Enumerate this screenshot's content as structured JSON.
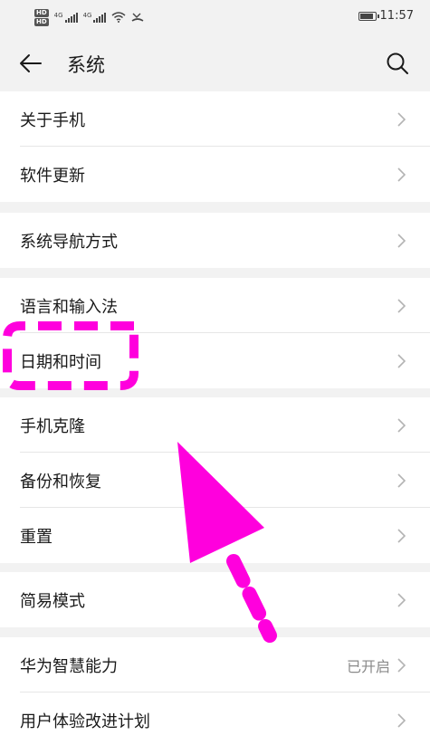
{
  "status_bar": {
    "hd_badges": [
      "HD",
      "HD"
    ],
    "sim1_label": "4G",
    "sim2_label": "4G",
    "time": "11:57",
    "battery_level": 0.9
  },
  "header": {
    "title": "系统",
    "back_icon": "arrow-left-icon",
    "search_icon": "search-icon"
  },
  "groups": [
    {
      "items": [
        {
          "label": "关于手机"
        },
        {
          "label": "软件更新"
        }
      ]
    },
    {
      "items": [
        {
          "label": "系统导航方式"
        }
      ]
    },
    {
      "items": [
        {
          "label": "语言和输入法"
        },
        {
          "label": "日期和时间"
        }
      ]
    },
    {
      "items": [
        {
          "label": "手机克隆"
        },
        {
          "label": "备份和恢复"
        },
        {
          "label": "重置"
        }
      ]
    },
    {
      "items": [
        {
          "label": "简易模式"
        }
      ]
    },
    {
      "items": [
        {
          "label": "华为智慧能力",
          "value": "已开启"
        },
        {
          "label": "用户体验改进计划"
        }
      ]
    }
  ],
  "annotation": {
    "color": "#ff00dd",
    "highlight_target": "日期和时间",
    "arrow_icon": "pointer-arrow-icon"
  }
}
